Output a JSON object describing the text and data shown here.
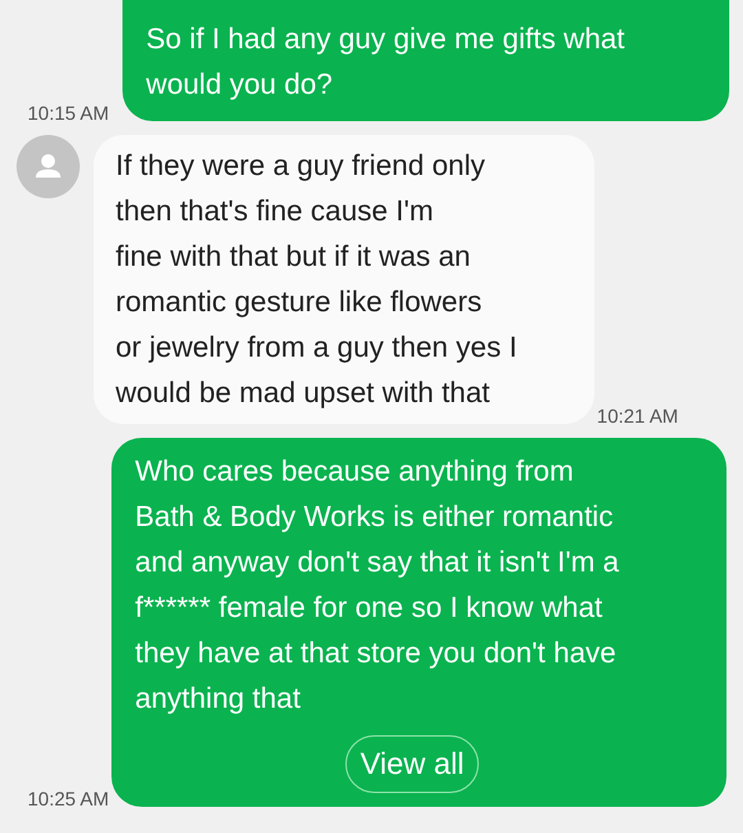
{
  "messages": [
    {
      "kind": "sent",
      "lines": [
        "So if I had any guy give me gifts what",
        "would you do?"
      ],
      "time": "10:15 AM"
    },
    {
      "kind": "received",
      "lines": [
        "If they were a guy friend only",
        "then that's fine cause I'm",
        "fine with that but if it was an",
        "romantic gesture like flowers",
        "or jewelry from a guy then yes I",
        "would be mad upset with that"
      ],
      "time": "10:21 AM"
    },
    {
      "kind": "sent",
      "lines": [
        "Who cares because anything from",
        "Bath & Body Works is either romantic",
        "and anyway don't say that it isn't I'm a",
        "f****** female for one so I know what",
        "they have at that store you don't have",
        "anything that"
      ],
      "button": "View all",
      "time": "10:25 AM"
    }
  ]
}
